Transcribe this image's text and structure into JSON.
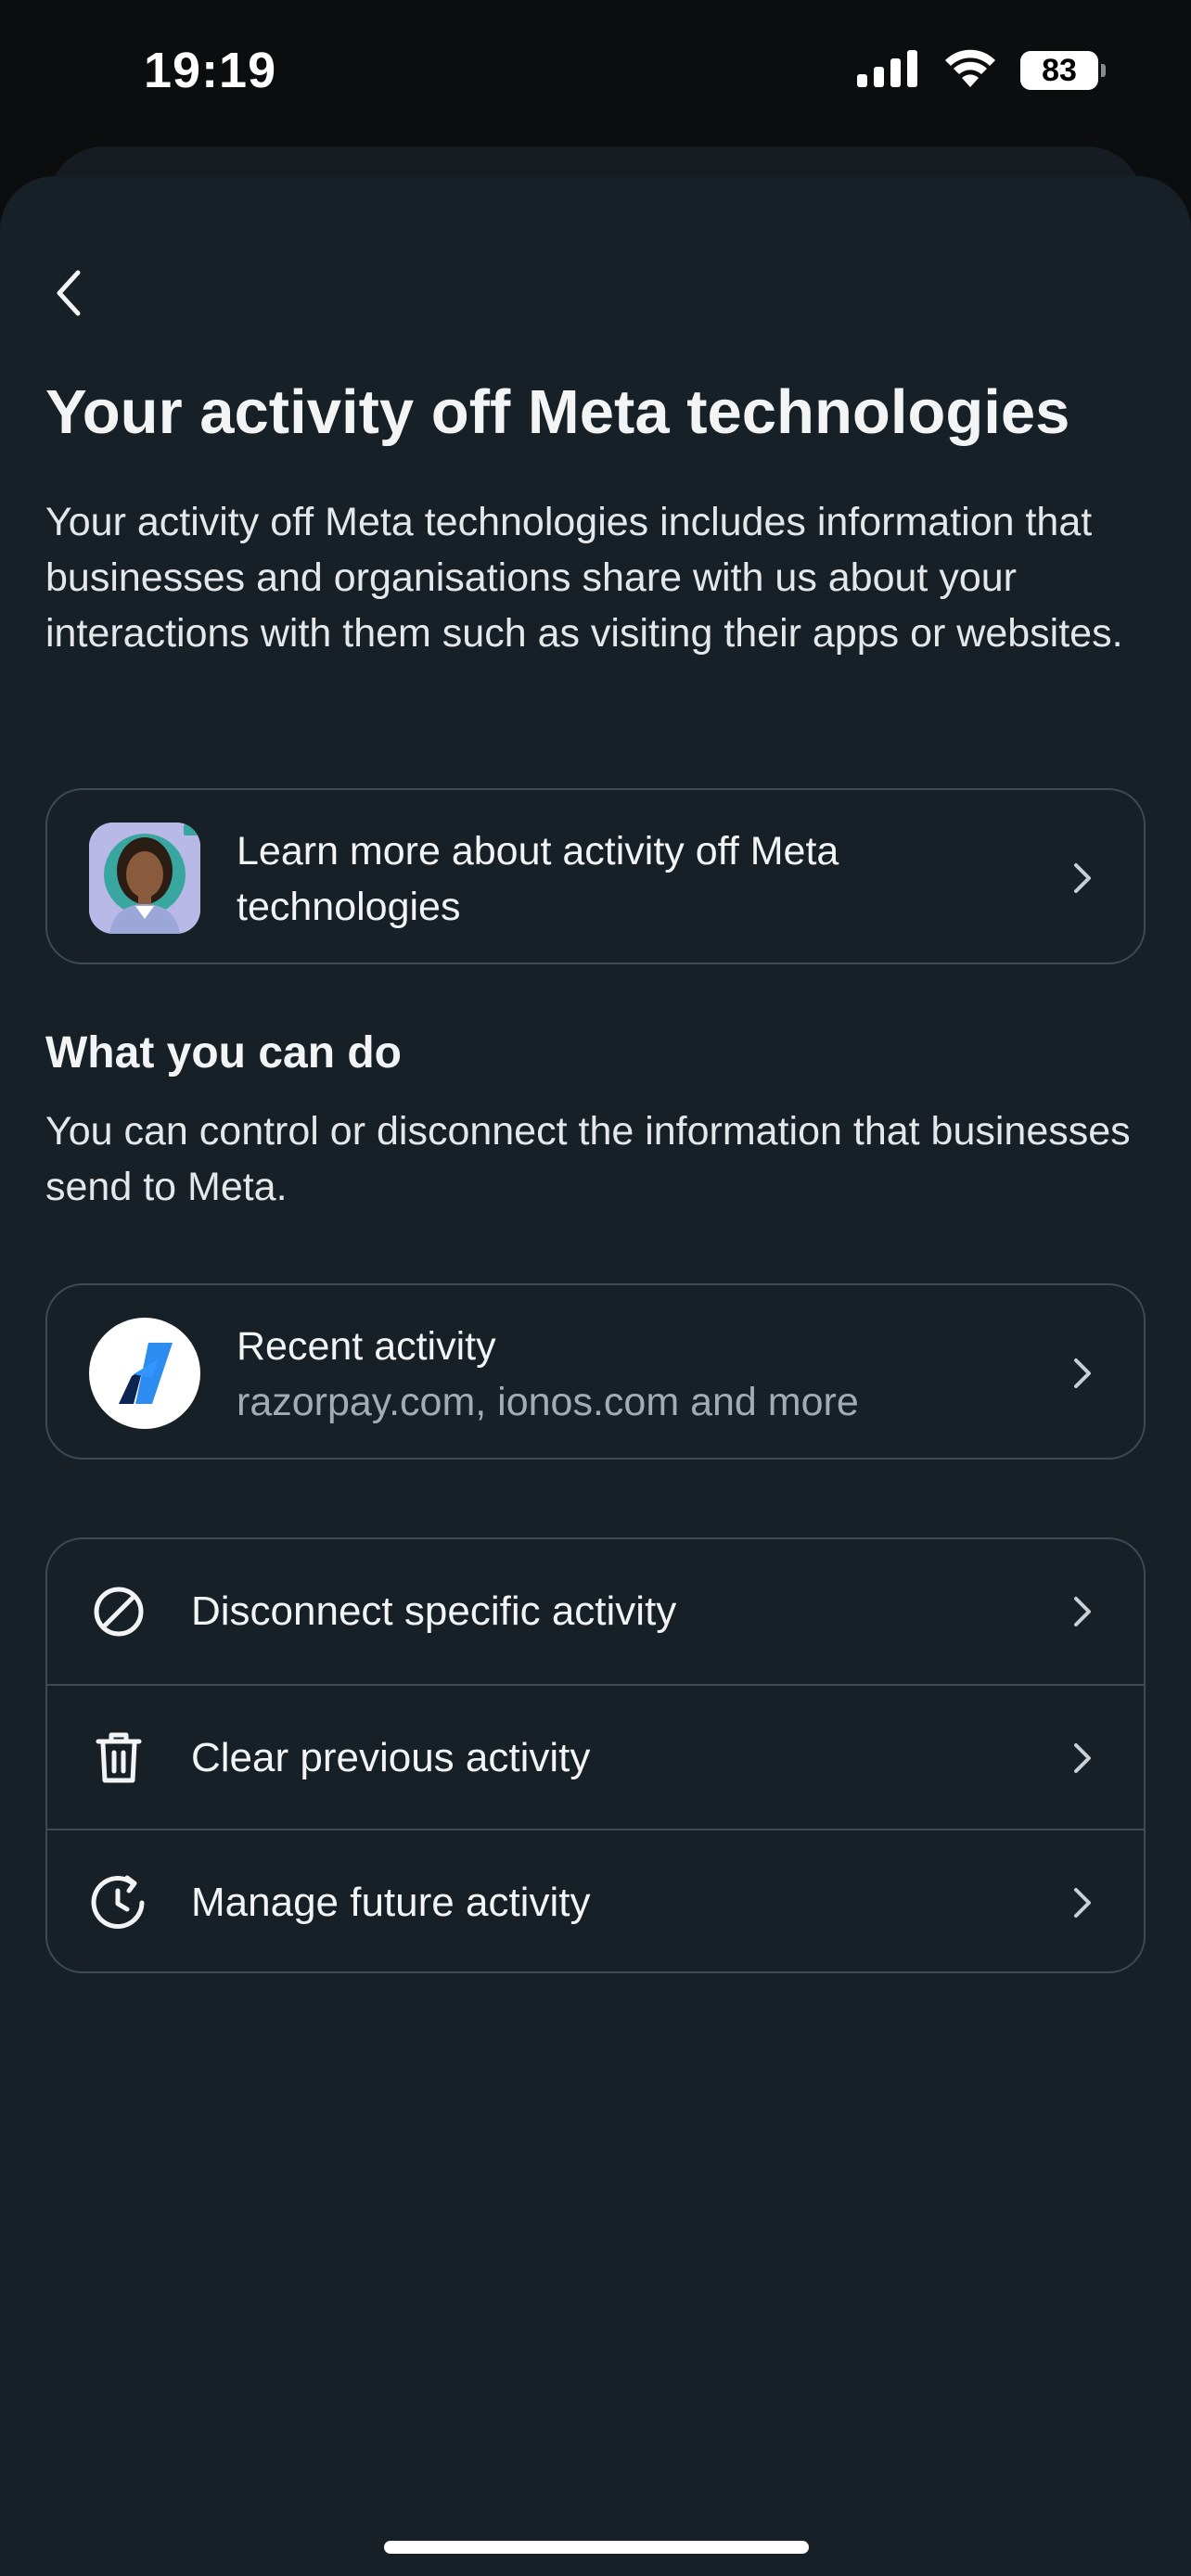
{
  "status_bar": {
    "time": "19:19",
    "battery": "83",
    "icons": [
      "signal-icon",
      "wifi-icon",
      "battery-icon"
    ]
  },
  "header": {
    "back_icon": "chevron-left-icon"
  },
  "page": {
    "title": "Your activity off Meta technologies",
    "intro": "Your activity off Meta technologies includes information that businesses and organisations share with us about your interactions with them such as visiting their apps or websites."
  },
  "learn_more": {
    "label": "Learn more about activity off Meta technologies",
    "icon": "avatar-illustration-icon"
  },
  "what_you_can_do": {
    "heading": "What you can do",
    "description": "You can control or disconnect the information that businesses send to Meta."
  },
  "recent_activity": {
    "title": "Recent activity",
    "subtitle": "razorpay.com, ionos.com and more",
    "icon": "razorpay-logo-icon"
  },
  "actions": [
    {
      "label": "Disconnect specific activity",
      "icon": "block-icon"
    },
    {
      "label": "Clear previous activity",
      "icon": "trash-icon"
    },
    {
      "label": "Manage future activity",
      "icon": "clock-refresh-icon"
    }
  ],
  "colors": {
    "background": "#172027",
    "card_border": "#3d4a54",
    "text_primary": "#f2f4f5",
    "text_secondary": "#a3acb3"
  }
}
